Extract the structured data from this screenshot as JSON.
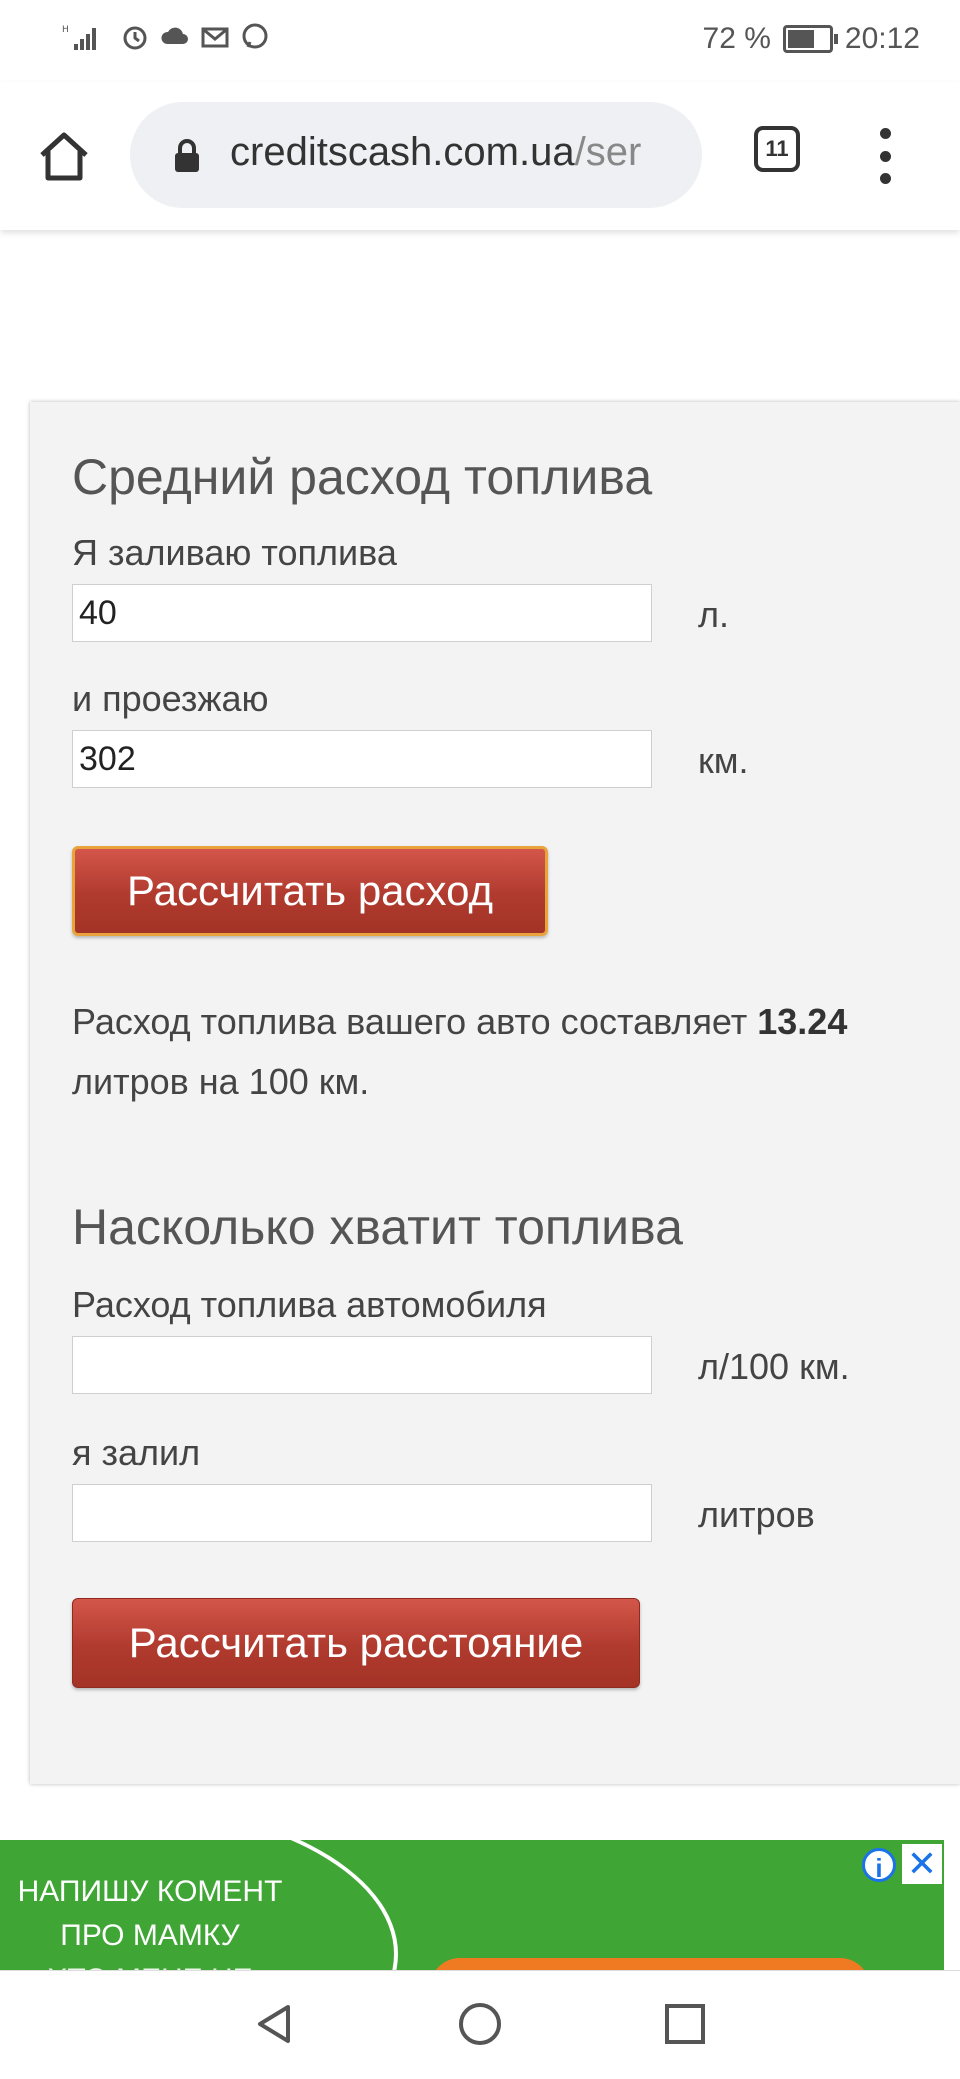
{
  "status_bar": {
    "battery": "72 %",
    "time": "20:12",
    "battery_level": 0.72
  },
  "browser": {
    "url_domain": "creditscash.com.ua",
    "url_path": "/ser",
    "tab_count": "11"
  },
  "consumption": {
    "title": "Средний расход топлива",
    "fuel_label": "Я заливаю топлива",
    "fuel_value": "40",
    "fuel_unit": "л.",
    "distance_label": "и проезжаю",
    "distance_value": "302",
    "distance_unit": "км.",
    "button": "Рассчитать расход",
    "result_prefix": "Расход топлива вашего авто составляет",
    "result_value": "13.24",
    "result_suffix": "литров на 100 км."
  },
  "range": {
    "title": "Насколько хватит топлива",
    "rate_label": "Расход топлива автомобиля",
    "rate_value": "",
    "rate_unit": "л/100 км.",
    "filled_label": "я залил",
    "filled_value": "",
    "filled_unit": "литров",
    "button": "Рассчитать расстояние"
  },
  "ad": {
    "line1": "НАПИШУ КОМЕНТ",
    "line2": "ПРО МАМКУ",
    "line3": "ХТО МЕНЕ НЕ ЗАЙДЕ",
    "info_icon": "i",
    "close_icon": "✕"
  },
  "colors": {
    "button_red": "#b03a2e",
    "ad_green": "#3fa535",
    "card_bg": "#f3f3f3"
  }
}
